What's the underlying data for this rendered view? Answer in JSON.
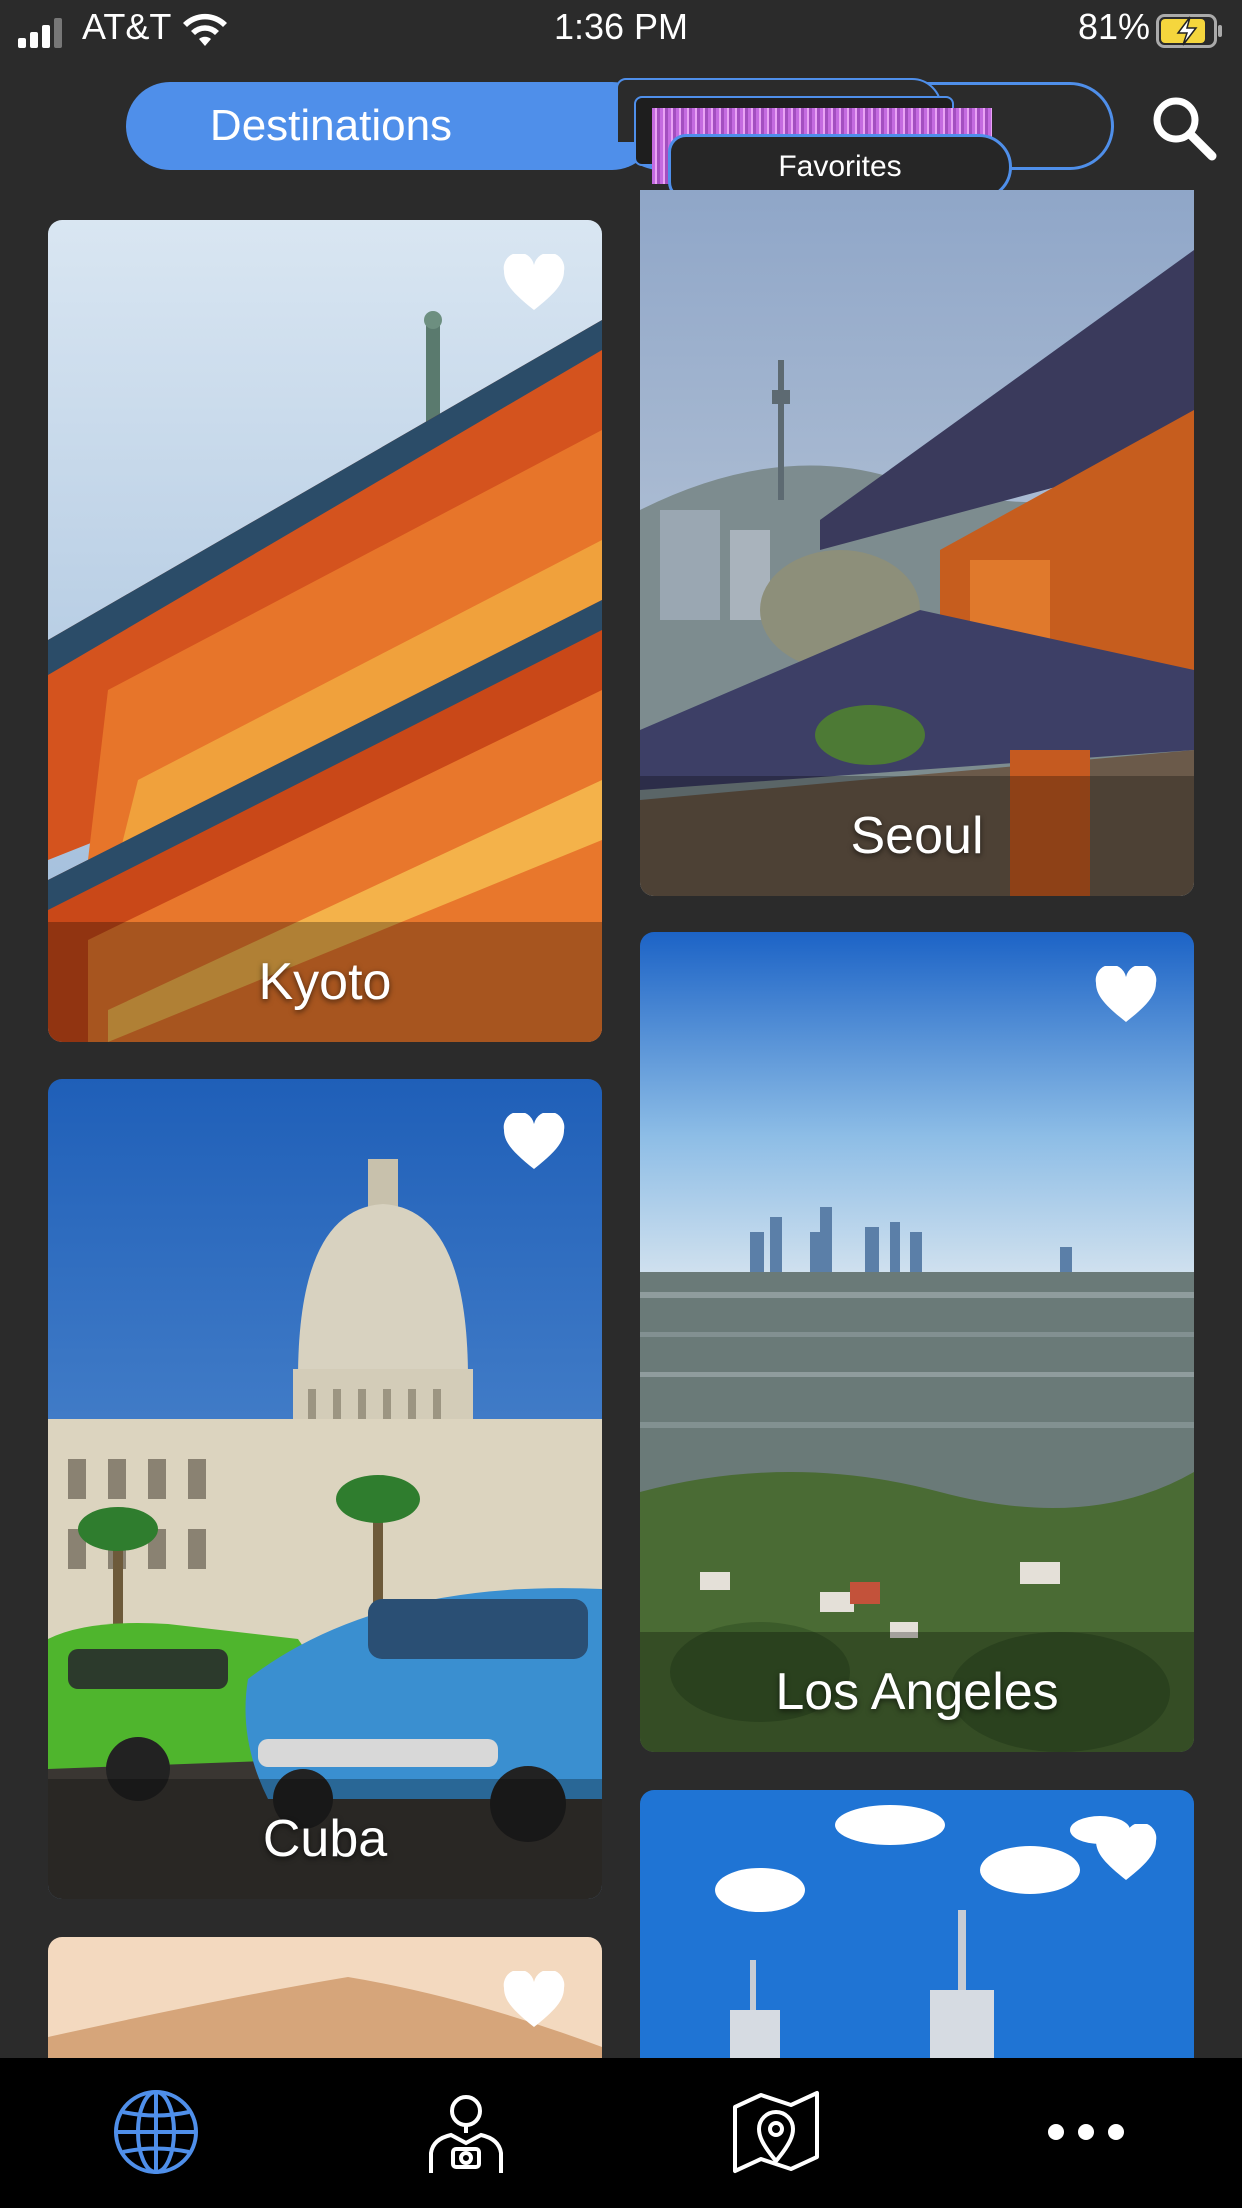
{
  "status_bar": {
    "carrier": "AT&T",
    "time": "1:36 PM",
    "battery_percent": "81%",
    "icons": [
      "signal-bars-icon",
      "wifi-icon",
      "battery-charging-icon"
    ]
  },
  "tabs": {
    "destinations_label": "Destinations",
    "favorites_label": "Favorites",
    "active": "Destinations"
  },
  "search": {
    "icon": "search-icon"
  },
  "destinations": [
    {
      "name": "Kyoto",
      "favorited": true
    },
    {
      "name": "Seoul",
      "favorited": true
    },
    {
      "name": "Cuba",
      "favorited": true
    },
    {
      "name": "Los Angeles",
      "favorited": true
    },
    {
      "name": "",
      "favorited": true
    },
    {
      "name": "",
      "favorited": true
    }
  ],
  "bottom_nav": {
    "items": [
      "globe-icon",
      "traveler-camera-icon",
      "map-pin-icon",
      "more-icon"
    ],
    "active": "globe-icon"
  },
  "colors": {
    "accent": "#4f8fea",
    "background": "#2b2b2b",
    "nav_background": "#000000"
  }
}
